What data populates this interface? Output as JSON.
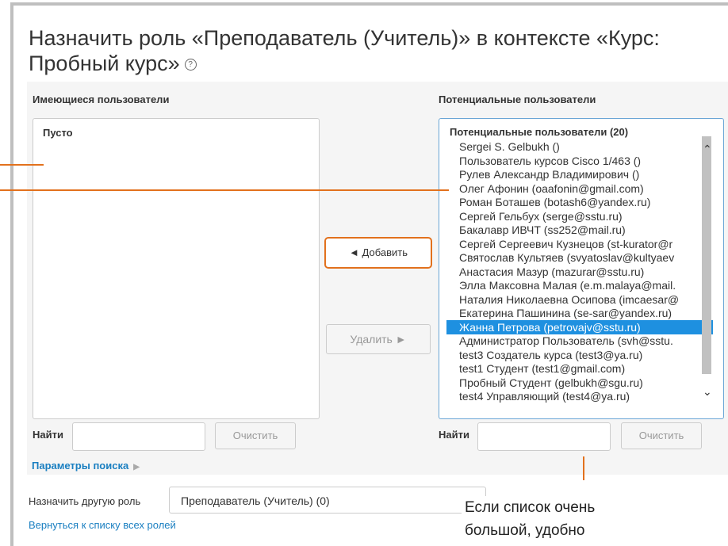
{
  "title": "Назначить роль «Преподаватель (Учитель)» в контексте «Курс: Пробный курс»",
  "help_icon": "?",
  "existing": {
    "label": "Имеющиеся пользователи",
    "empty_text": "Пусто",
    "find_label": "Найти",
    "find_value": "",
    "clear_label": "Очистить"
  },
  "potential": {
    "label": "Потенциальные пользователи",
    "group_label": "Потенциальные пользователи (20)",
    "options": [
      "Sergei S. Gelbukh ()",
      "Пользователь курсов Cisco 1/463 ()",
      "Рулев Александр Владимирович ()",
      "Олег Афонин (oaafonin@gmail.com)",
      "Роман Боташев (botash6@yandex.ru)",
      "Сергей Гельбух (serge@sstu.ru)",
      "Бакалавр ИВЧТ (ss252@mail.ru)",
      "Сергей Сергеевич Кузнецов (st-kurator@r",
      "Святослав Культяев (svyatoslav@kultyaev",
      "Анастасия Мазур (mazurar@sstu.ru)",
      "Элла Максовна Малая (e.m.malaya@mail.",
      "Наталия Николаевна Осипова (imcaesar@",
      "Екатерина Пашинина (se-sar@yandex.ru)",
      "Жанна Петрова (petrovajv@sstu.ru)",
      "Администратор Пользователь (svh@sstu.",
      "test3 Создатель курса (test3@ya.ru)",
      "test1 Студент (test1@gmail.com)",
      "Пробный Студент (gelbukh@sgu.ru)",
      "test4 Управляющий (test4@ya.ru)"
    ],
    "selected_index": 13,
    "find_label": "Найти",
    "find_value": "",
    "clear_label": "Очистить"
  },
  "buttons": {
    "add_label": "◄ Добавить",
    "remove_label": "Удалить ►"
  },
  "search_params_label": "Параметры поиска",
  "other_role": {
    "label": "Назначить другую роль",
    "selected": "Преподаватель (Учитель) (0)"
  },
  "back_link": "Вернуться к списку всех ролей",
  "callout": {
    "line1": "Если список очень",
    "line2": "большой, удобно"
  },
  "colors": {
    "accent_orange": "#e2711d",
    "selection_blue": "#1e90e0",
    "link_blue": "#1a7fc1"
  }
}
